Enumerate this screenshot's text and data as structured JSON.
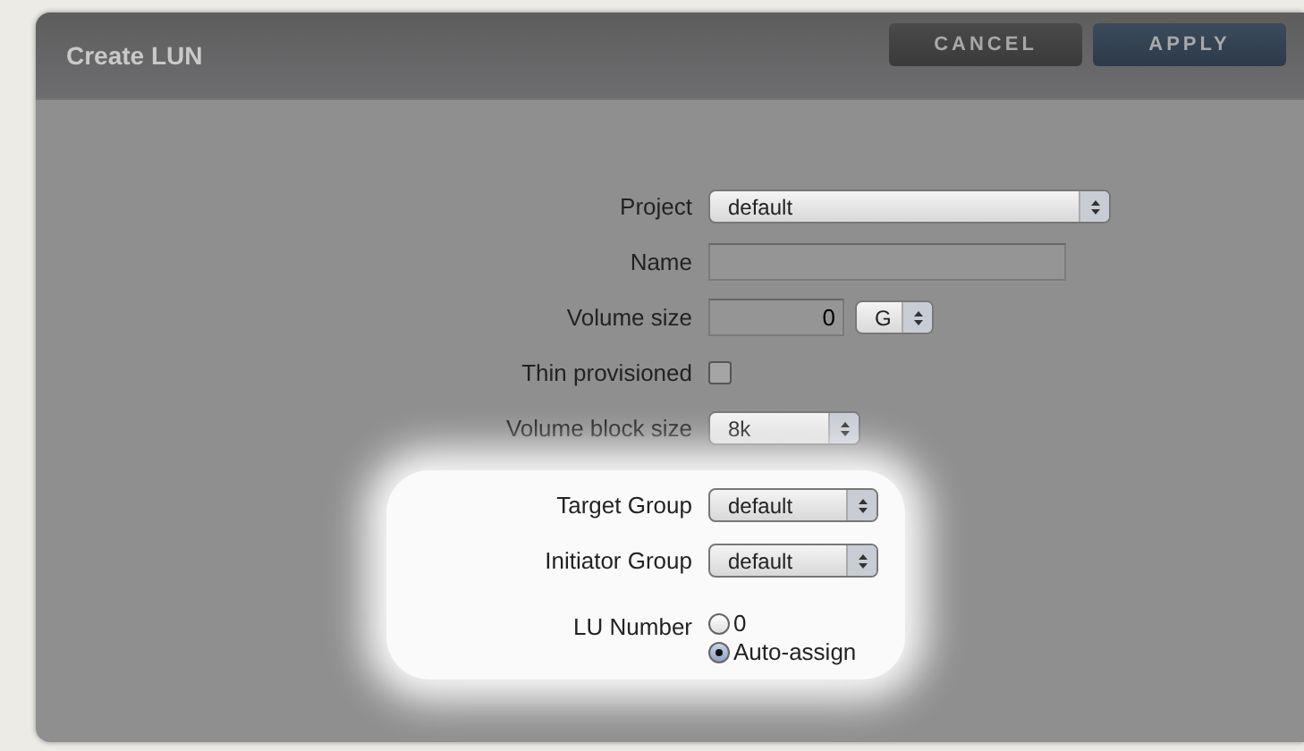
{
  "window": {
    "title": "Create LUN"
  },
  "buttons": [
    {
      "label": "CANCEL",
      "kind": "secondary"
    },
    {
      "label": "APPLY",
      "kind": "primary"
    }
  ],
  "fields": [
    {
      "kind": "select",
      "label": "Project",
      "value": "default",
      "highlighted": false
    },
    {
      "kind": "text",
      "label": "Name",
      "highlighted": false
    },
    {
      "kind": "size",
      "label": "Volume size",
      "value": "0",
      "unit": "G",
      "highlighted": false
    },
    {
      "kind": "checkbox",
      "label": "Thin provisioned",
      "checked": false,
      "highlighted": false
    },
    {
      "kind": "select",
      "label": "Volume block size",
      "value": "8k",
      "highlighted": false
    },
    {
      "kind": "select",
      "label": "Target Group",
      "value": "default",
      "highlighted": true
    },
    {
      "kind": "select",
      "label": "Initiator Group",
      "value": "default",
      "highlighted": true
    },
    {
      "kind": "radio",
      "label": "LU Number",
      "options": [
        {
          "label": "0",
          "selected": false
        },
        {
          "label": "Auto-assign",
          "selected": true
        }
      ],
      "highlighted": true
    }
  ]
}
